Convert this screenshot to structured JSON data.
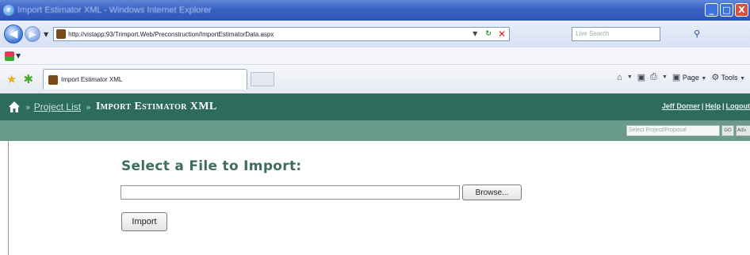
{
  "window": {
    "title": "Import Estimator XML - Windows Internet Explorer",
    "minimize_glyph": "_",
    "maximize_glyph": "□",
    "close_glyph": "X"
  },
  "addressbar": {
    "url": "http://vistapp:93/Trimport.Web/Preconstruction/ImportEstimatorData.aspx",
    "search_placeholder": "Live Search"
  },
  "tab": {
    "label": "Import Estimator XML"
  },
  "commandbar": {
    "page_label": "Page",
    "tools_label": "Tools"
  },
  "app": {
    "breadcrumb_link": "Project List",
    "current_page": "Import Estimator XML",
    "user_name": "Jeff Dorner",
    "help_label": "Help",
    "logout_label": "Logout",
    "project_search_placeholder": "Select Project/Proposal",
    "go_label": "GO",
    "advanced_label": "Adv"
  },
  "form": {
    "heading": "Select a File to Import:",
    "browse_label": "Browse...",
    "import_label": "Import",
    "file_value": ""
  },
  "colors": {
    "header_green": "#2d6b5a",
    "subheader_green": "#6a9a8c",
    "heading_green": "#3d6e61"
  },
  "icons": [
    "ie-logo-icon",
    "back-arrow-icon",
    "forward-arrow-icon",
    "page-icon",
    "refresh-icon",
    "stop-icon",
    "search-icon",
    "favorites-star-icon",
    "add-favorites-icon",
    "home-icon",
    "rss-icon",
    "print-icon"
  ]
}
